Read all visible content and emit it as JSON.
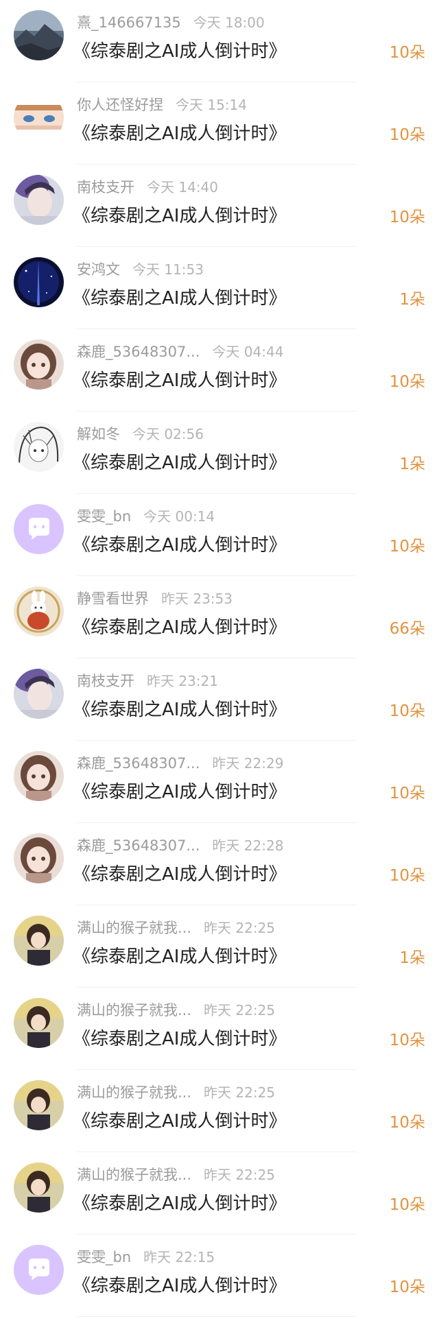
{
  "colors": {
    "accent_amount": "#e2923f",
    "name_gray": "#9b9b9b",
    "title_dark": "#222222",
    "app_avatar_purple": "#d9c4ff"
  },
  "rows": [
    {
      "name": "熹_146667135",
      "time": "今天 18:00",
      "title": "《综泰剧之AI成人倒计时》",
      "amount": "10朵",
      "avatar": "landscape-avatar"
    },
    {
      "name": "你人还怪好捏",
      "time": "今天 15:14",
      "title": "《综泰剧之AI成人倒计时》",
      "amount": "10朵",
      "avatar": "anime-eyes-avatar"
    },
    {
      "name": "南枝支开",
      "time": "今天 14:40",
      "title": "《综泰剧之AI成人倒计时》",
      "amount": "10朵",
      "avatar": "portrait-male-avatar"
    },
    {
      "name": "安鸿文",
      "time": "今天 11:53",
      "title": "《综泰剧之AI成人倒计时》",
      "amount": "1朵",
      "avatar": "night-sky-avatar"
    },
    {
      "name": "森鹿_53648307...",
      "time": "今天 04:44",
      "title": "《综泰剧之AI成人倒计时》",
      "amount": "10朵",
      "avatar": "anime-girl-avatar"
    },
    {
      "name": "解如冬",
      "time": "今天 02:56",
      "title": "《综泰剧之AI成人倒计时》",
      "amount": "1朵",
      "avatar": "sketch-girl-avatar"
    },
    {
      "name": "雯雯_bn",
      "time": "今天 00:14",
      "title": "《综泰剧之AI成人倒计时》",
      "amount": "10朵",
      "avatar": "default-app-avatar"
    },
    {
      "name": "静雪看世界",
      "time": "昨天 23:53",
      "title": "《综泰剧之AI成人倒计时》",
      "amount": "66朵",
      "avatar": "rabbit-avatar"
    },
    {
      "name": "南枝支开",
      "time": "昨天 23:21",
      "title": "《综泰剧之AI成人倒计时》",
      "amount": "10朵",
      "avatar": "portrait-male-avatar"
    },
    {
      "name": "森鹿_53648307...",
      "time": "昨天 22:29",
      "title": "《综泰剧之AI成人倒计时》",
      "amount": "10朵",
      "avatar": "anime-girl-avatar"
    },
    {
      "name": "森鹿_53648307...",
      "time": "昨天 22:28",
      "title": "《综泰剧之AI成人倒计时》",
      "amount": "10朵",
      "avatar": "anime-girl-avatar"
    },
    {
      "name": "满山的猴子就我...",
      "time": "昨天 22:25",
      "title": "《综泰剧之AI成人倒计时》",
      "amount": "1朵",
      "avatar": "anime-boy-avatar"
    },
    {
      "name": "满山的猴子就我...",
      "time": "昨天 22:25",
      "title": "《综泰剧之AI成人倒计时》",
      "amount": "10朵",
      "avatar": "anime-boy-avatar"
    },
    {
      "name": "满山的猴子就我...",
      "time": "昨天 22:25",
      "title": "《综泰剧之AI成人倒计时》",
      "amount": "10朵",
      "avatar": "anime-boy-avatar"
    },
    {
      "name": "满山的猴子就我...",
      "time": "昨天 22:25",
      "title": "《综泰剧之AI成人倒计时》",
      "amount": "10朵",
      "avatar": "anime-boy-avatar"
    },
    {
      "name": "雯雯_bn",
      "time": "昨天 22:15",
      "title": "《综泰剧之AI成人倒计时》",
      "amount": "10朵",
      "avatar": "default-app-avatar"
    }
  ]
}
